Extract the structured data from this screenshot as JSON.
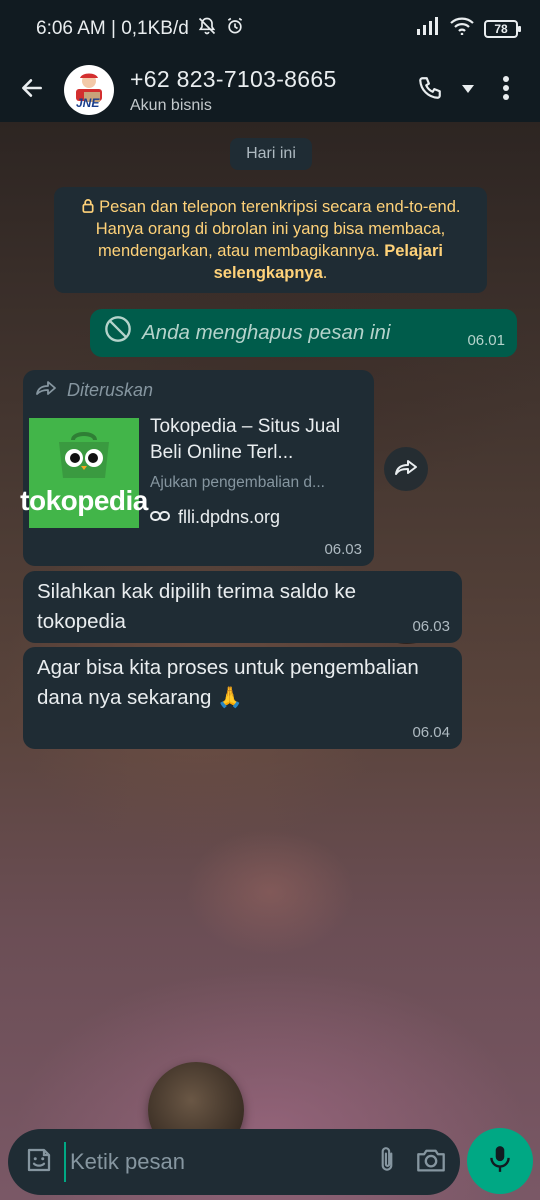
{
  "status_bar": {
    "time_info": "6:06 AM | 0,1KB/d",
    "battery": "78"
  },
  "header": {
    "contact_name": "+62 823-7103-8665",
    "subtitle": "Akun bisnis",
    "avatar_text": "JNE"
  },
  "chat": {
    "date_label": "Hari ini",
    "encryption_notice": "Pesan dan telepon terenkripsi secara end-to-end. Hanya orang di obrolan ini yang bisa membaca, mendengarkan, atau membagikannya.",
    "encryption_link": "Pelajari selengkapnya",
    "messages": [
      {
        "text": "Anda menghapus pesan ini",
        "time": "06.01"
      },
      {
        "forwarded_label": "Diteruskan",
        "link_title": "Tokopedia – Situs Jual Beli Online Terl...",
        "link_desc": "Ajukan pengembalian d...",
        "link_url": "flli.dpdns.org",
        "thumb_text": "tokopedia",
        "time": "06.03"
      },
      {
        "text": "Silahkan kak dipilih terima saldo ke tokopedia",
        "time": "06.03"
      },
      {
        "text": "Agar bisa kita proses untuk pengembalian dana nya sekarang 🙏",
        "time": "06.04"
      }
    ]
  },
  "composer": {
    "placeholder": "Ketik pesan"
  },
  "colors": {
    "header_bg": "#111b21",
    "incoming_bubble": "#1f2c34",
    "outgoing_bubble": "#005c4b",
    "accent": "#00a884",
    "notice_text": "#ffd279",
    "tokopedia_green": "#42b549"
  }
}
